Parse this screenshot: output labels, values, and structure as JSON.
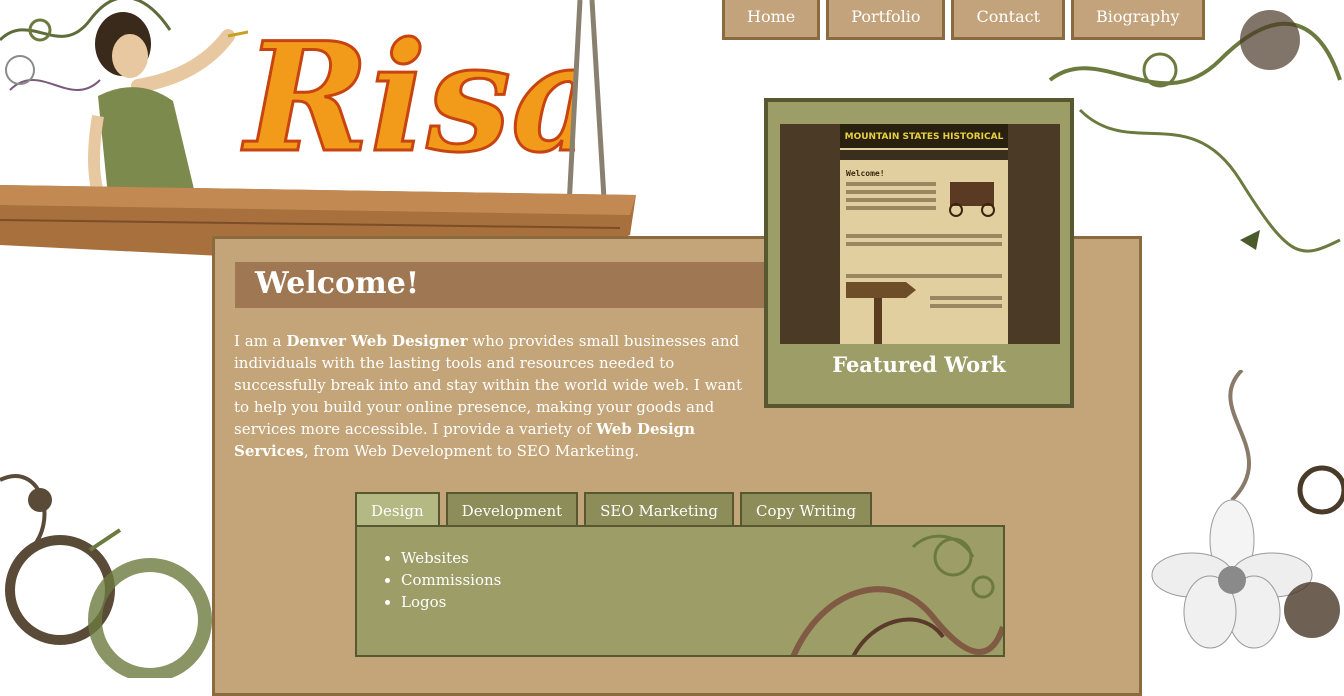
{
  "logo": {
    "text": "Risa"
  },
  "nav": {
    "items": [
      {
        "label": "Home"
      },
      {
        "label": "Portfolio"
      },
      {
        "label": "Contact"
      },
      {
        "label": "Biography"
      }
    ]
  },
  "welcome": {
    "title": "Welcome!",
    "intro_1": "I am a ",
    "intro_bold_1": "Denver Web Designer",
    "intro_2": " who provides small businesses and individuals with the lasting tools and resources needed to successfully break into and stay within the world wide web. I want to help you build your online presence, making your goods and services more accessible. I provide a variety of ",
    "intro_bold_2": "Web Design Services",
    "intro_3": ", from Web Development to SEO Marketing."
  },
  "featured": {
    "label": "Featured Work",
    "preview_title": "MOUNTAIN STATES HISTORICAL",
    "preview_heading": "Welcome!"
  },
  "tabs": {
    "items": [
      {
        "label": "Design"
      },
      {
        "label": "Development"
      },
      {
        "label": "SEO Marketing"
      },
      {
        "label": "Copy Writing"
      }
    ],
    "active_index": 0,
    "content": [
      "Websites",
      "Commissions",
      "Logos"
    ]
  },
  "colors": {
    "panel": "#c4a579",
    "panel_border": "#8b6a3f",
    "green_panel": "#9d9d68",
    "green_border": "#57582f",
    "active_tab": "#b4b883",
    "welcome_bar": "#9f7752"
  }
}
